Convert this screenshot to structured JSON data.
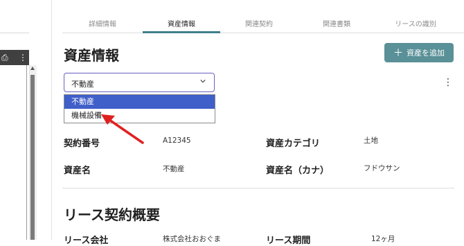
{
  "tabs": [
    {
      "label": "詳細情報",
      "active": false
    },
    {
      "label": "資産情報",
      "active": true
    },
    {
      "label": "関連契約",
      "active": false
    },
    {
      "label": "関連書類",
      "active": false
    },
    {
      "label": "リースの識別",
      "active": false
    }
  ],
  "section": {
    "title": "資産情報",
    "add_button_label": "資産を追加"
  },
  "asset_select": {
    "value": "不動産",
    "options": [
      "不動産",
      "機械設備"
    ],
    "selected_index": 0
  },
  "fields": {
    "contract_number": {
      "label": "契約番号",
      "value": "A12345"
    },
    "asset_category": {
      "label": "資産カテゴリ",
      "value": "土地"
    },
    "asset_name": {
      "label": "資産名",
      "value": "不動産"
    },
    "asset_name_kana": {
      "label": "資産名（カナ）",
      "value": "フドウサン"
    }
  },
  "lease_overview": {
    "title": "リース契約概要",
    "lessor": {
      "label": "リース会社",
      "value": "株式会社おおぐま"
    },
    "lease_period": {
      "label": "リース期間",
      "value": "12ヶ月"
    }
  },
  "colors": {
    "accent_teal": "#5a9097",
    "tab_indicator": "#3f7f8c",
    "select_border": "#6a5fc1",
    "option_highlight": "#3f5fc9",
    "annotation_arrow": "#e02020"
  }
}
